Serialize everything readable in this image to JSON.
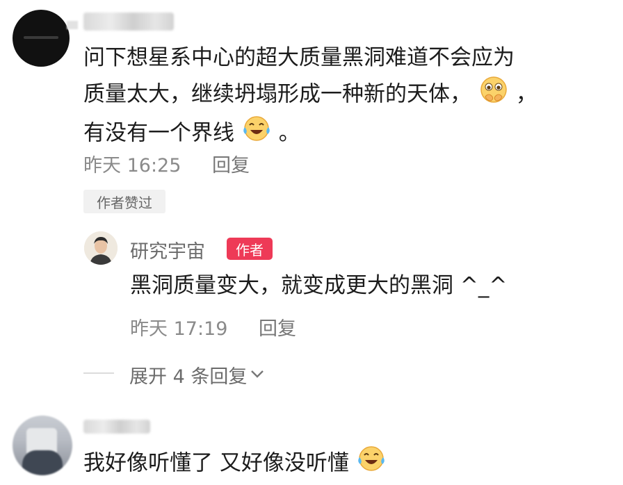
{
  "comment1": {
    "lines": [
      "问下想星系中心的超大质量黑洞难道不会应为",
      "质量太大，继续坍塌形成一种新的天体，",
      "，",
      "有没有一个界线",
      "。"
    ],
    "time": "昨天 16:25",
    "reply_label": "回复",
    "liked_badge": "作者赞过"
  },
  "author_reply": {
    "name": "研究宇宙",
    "badge": "作者",
    "text": "黑洞质量变大，就变成更大的黑洞 ^_^",
    "time": "昨天 17:19",
    "reply_label": "回复"
  },
  "expand": {
    "label": "展开 4 条回复"
  },
  "comment2": {
    "text": "我好像听懂了 又好像没听懂"
  },
  "icons": {
    "pleading": "pleading-hands-icon",
    "cry_laugh": "crying-laughing-icon",
    "chevron": "chevron-down-icon"
  },
  "colors": {
    "author_badge": "#ee3a57",
    "meta_gray": "#8a8a8a"
  }
}
